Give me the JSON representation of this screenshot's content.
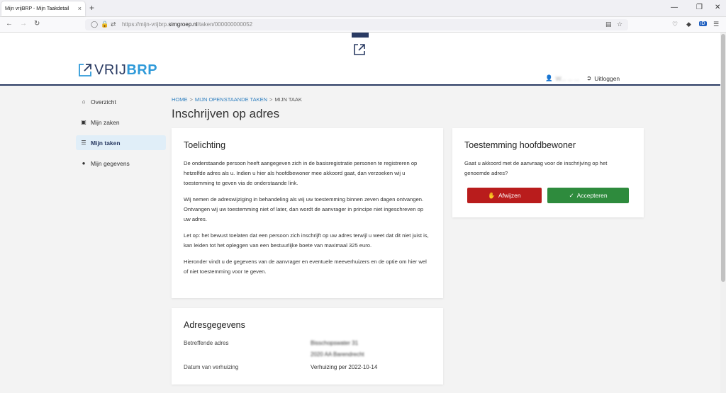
{
  "browser": {
    "tab_title": "Mijn vrijBRP - Mijn Taakdetail",
    "tab_close": "×",
    "new_tab": "+",
    "url_prefix": "https://mijn-vrijbrp.",
    "url_domain": "simgroep.nl",
    "url_path": "/taken/000000000052"
  },
  "header": {
    "logo_part1": "VRIJ",
    "logo_part2": "BRP",
    "user_name": "W... ... ...",
    "logout_label": "Uitloggen"
  },
  "sidebar": {
    "items": [
      {
        "label": "Overzicht",
        "icon": "home-icon"
      },
      {
        "label": "Mijn zaken",
        "icon": "archive-icon"
      },
      {
        "label": "Mijn taken",
        "icon": "tasks-icon"
      },
      {
        "label": "Mijn gegevens",
        "icon": "user-icon"
      }
    ]
  },
  "breadcrumb": {
    "home": "HOME",
    "sep": ">",
    "open_tasks": "MIJN OPENSTAANDE TAKEN",
    "current": "MIJN TAAK"
  },
  "page_title": "Inschrijven op adres",
  "explanation": {
    "title": "Toelichting",
    "p1": "De onderstaande persoon heeft aangegeven zich in de basisregistratie personen te registreren op hetzelfde adres als u. Indien u hier als hoofdbewoner mee akkoord gaat, dan verzoeken wij u toestemming te geven via de onderstaande link.",
    "p2": "Wij nemen de adreswijziging in behandeling als wij uw toestemming binnen zeven dagen ontvangen. Ontvangen wij uw toestemming niet of later, dan wordt de aanvrager in principe niet ingeschreven op uw adres.",
    "p3": "Let op: het bewust toelaten dat een persoon zich inschrijft op uw adres terwijl u weet dat dit niet juist is, kan leiden tot het opleggen van een bestuurlijke boete van maximaal 325 euro.",
    "p4": "Hieronder vindt u de gegevens van de aanvrager en eventuele meeverhuizers en de optie om hier wel of niet toestemming voor te geven."
  },
  "consent": {
    "title": "Toestemming hoofdbewoner",
    "question": "Gaat u akkoord met de aanvraag voor de inschrijving op het genoemde adres?",
    "reject_label": "Afwijzen",
    "accept_label": "Accepteren",
    "reject_color": "#b91c1c",
    "accept_color": "#2e8b3d"
  },
  "address": {
    "title": "Adresgegevens",
    "address_label": "Betreffende adres",
    "address_line1": "Bisschopswater 31",
    "address_line2": "2020 AA Barendrecht",
    "date_label": "Datum van verhuizing",
    "date_value": "Verhuizing per 2022-10-14"
  }
}
